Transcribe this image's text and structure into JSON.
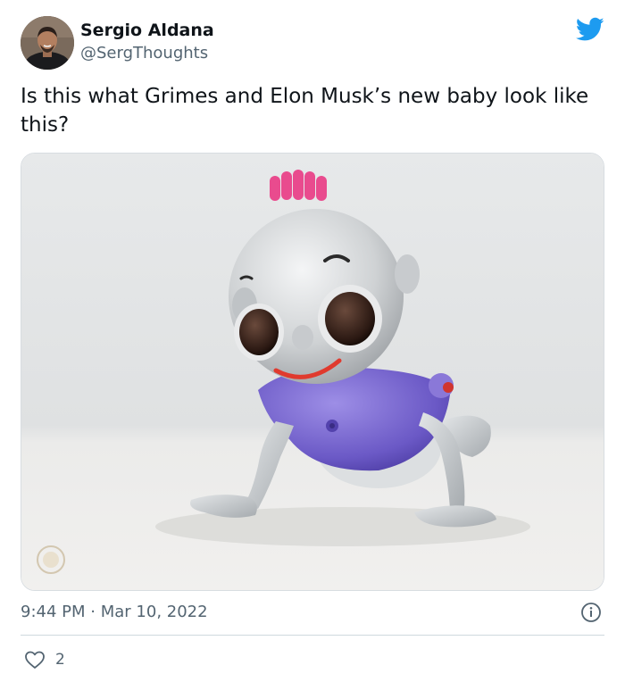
{
  "author": {
    "name": "Sergio Aldana",
    "handle": "@SergThoughts",
    "avatar_icon": "avatar"
  },
  "tweet": {
    "text": "Is this what Grimes and Elon Musk’s new baby look like this?",
    "time": "9:44 PM",
    "separator": "·",
    "date": "Mar 10, 2022"
  },
  "media": {
    "subject": "robot-baby-toy-photo"
  },
  "engagement": {
    "likes": "2",
    "like_icon": "heart-icon"
  },
  "icons": {
    "brand": "twitter-bird-icon",
    "info": "info-icon"
  },
  "colors": {
    "brand": "#1d9bf0",
    "text": "#0f1419",
    "secondary": "#536471",
    "divider": "#cfd9de"
  }
}
